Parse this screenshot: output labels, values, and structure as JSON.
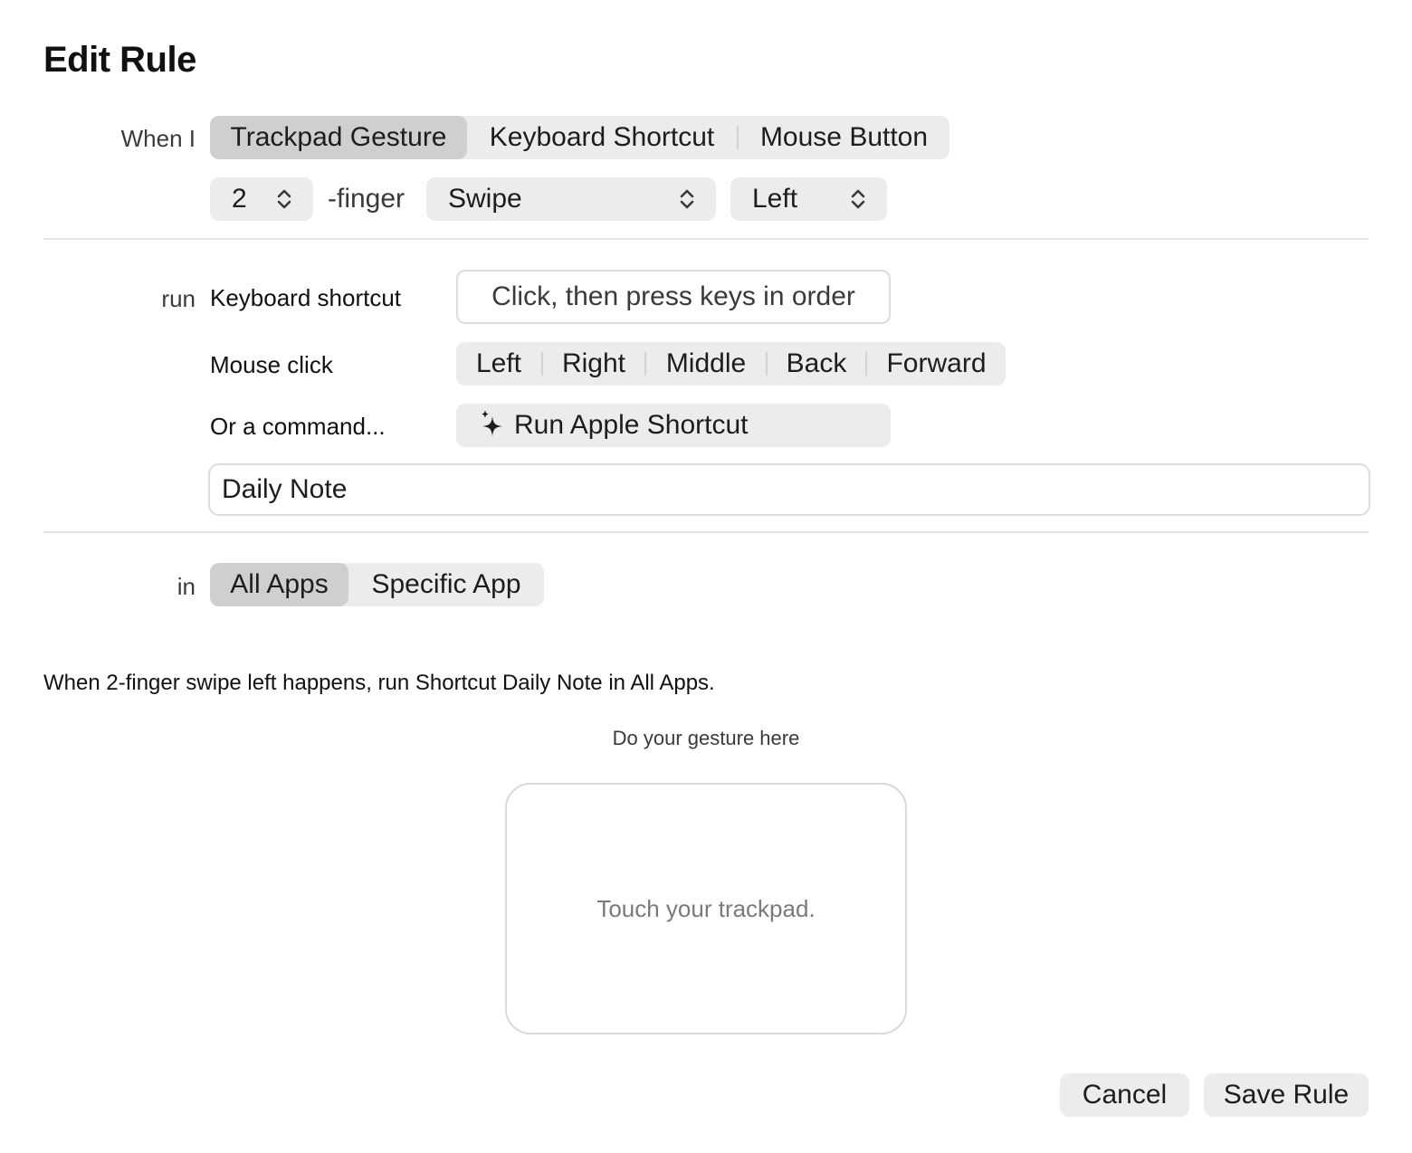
{
  "title": "Edit Rule",
  "trigger": {
    "label": "When I",
    "types": [
      "Trackpad Gesture",
      "Keyboard Shortcut",
      "Mouse Button"
    ],
    "selected_type": "Trackpad Gesture",
    "finger_count": "2",
    "finger_suffix": "-finger",
    "gesture": "Swipe",
    "direction": "Left"
  },
  "action": {
    "label": "run",
    "keyboard_shortcut_label": "Keyboard shortcut",
    "keyboard_shortcut_placeholder": "Click, then press keys in order",
    "mouse_click_label": "Mouse click",
    "mouse_buttons": [
      "Left",
      "Right",
      "Middle",
      "Back",
      "Forward"
    ],
    "command_label": "Or a command...",
    "run_shortcut_label": "Run Apple Shortcut",
    "shortcut_name": "Daily Note"
  },
  "scope": {
    "label": "in",
    "options": [
      "All Apps",
      "Specific App"
    ],
    "selected": "All Apps"
  },
  "summary": "When 2-finger swipe left happens, run Shortcut Daily Note in All Apps.",
  "gesture_area": {
    "hint": "Do your gesture here",
    "placeholder": "Touch your trackpad."
  },
  "buttons": {
    "cancel": "Cancel",
    "save": "Save Rule"
  }
}
